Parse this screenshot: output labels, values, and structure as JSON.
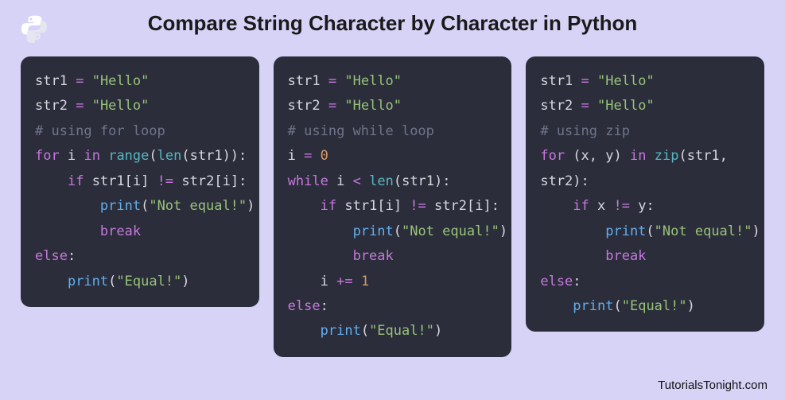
{
  "title": "Compare String Character by Character in Python",
  "attribution": "TutorialsTonight.com",
  "logo_name": "python-logo",
  "panels": [
    {
      "name": "for-loop-panel",
      "comment": "# using for loop",
      "code": [
        [
          [
            "var",
            "str1"
          ],
          [
            "pun",
            " "
          ],
          [
            "op",
            "="
          ],
          [
            "pun",
            " "
          ],
          [
            "str",
            "\"Hello\""
          ]
        ],
        [
          [
            "var",
            "str2"
          ],
          [
            "pun",
            " "
          ],
          [
            "op",
            "="
          ],
          [
            "pun",
            " "
          ],
          [
            "str",
            "\"Hello\""
          ]
        ],
        [
          [
            "com",
            "# using for loop"
          ]
        ],
        [
          [
            "kw",
            "for"
          ],
          [
            "pun",
            " "
          ],
          [
            "var",
            "i"
          ],
          [
            "pun",
            " "
          ],
          [
            "kw",
            "in"
          ],
          [
            "pun",
            " "
          ],
          [
            "bfn",
            "range"
          ],
          [
            "pun",
            "("
          ],
          [
            "bfn",
            "len"
          ],
          [
            "pun",
            "("
          ],
          [
            "var",
            "str1"
          ],
          [
            "pun",
            "))"
          ],
          [
            "pun",
            ":"
          ]
        ],
        [
          [
            "pun",
            "    "
          ],
          [
            "kw",
            "if"
          ],
          [
            "pun",
            " "
          ],
          [
            "var",
            "str1"
          ],
          [
            "pun",
            "["
          ],
          [
            "var",
            "i"
          ],
          [
            "pun",
            "]"
          ],
          [
            "pun",
            " "
          ],
          [
            "op",
            "!="
          ],
          [
            "pun",
            " "
          ],
          [
            "var",
            "str2"
          ],
          [
            "pun",
            "["
          ],
          [
            "var",
            "i"
          ],
          [
            "pun",
            "]"
          ],
          [
            "pun",
            ":"
          ]
        ],
        [
          [
            "pun",
            "        "
          ],
          [
            "fn",
            "print"
          ],
          [
            "pun",
            "("
          ],
          [
            "str",
            "\"Not equal!\""
          ],
          [
            "pun",
            ")"
          ]
        ],
        [
          [
            "pun",
            "        "
          ],
          [
            "kw",
            "break"
          ]
        ],
        [
          [
            "kw",
            "else"
          ],
          [
            "pun",
            ":"
          ]
        ],
        [
          [
            "pun",
            "    "
          ],
          [
            "fn",
            "print"
          ],
          [
            "pun",
            "("
          ],
          [
            "str",
            "\"Equal!\""
          ],
          [
            "pun",
            ")"
          ]
        ]
      ]
    },
    {
      "name": "while-loop-panel",
      "comment": "# using while loop",
      "code": [
        [
          [
            "var",
            "str1"
          ],
          [
            "pun",
            " "
          ],
          [
            "op",
            "="
          ],
          [
            "pun",
            " "
          ],
          [
            "str",
            "\"Hello\""
          ]
        ],
        [
          [
            "var",
            "str2"
          ],
          [
            "pun",
            " "
          ],
          [
            "op",
            "="
          ],
          [
            "pun",
            " "
          ],
          [
            "str",
            "\"Hello\""
          ]
        ],
        [
          [
            "com",
            "# using while loop"
          ]
        ],
        [
          [
            "var",
            "i"
          ],
          [
            "pun",
            " "
          ],
          [
            "op",
            "="
          ],
          [
            "pun",
            " "
          ],
          [
            "num",
            "0"
          ]
        ],
        [
          [
            "kw",
            "while"
          ],
          [
            "pun",
            " "
          ],
          [
            "var",
            "i"
          ],
          [
            "pun",
            " "
          ],
          [
            "op",
            "<"
          ],
          [
            "pun",
            " "
          ],
          [
            "bfn",
            "len"
          ],
          [
            "pun",
            "("
          ],
          [
            "var",
            "str1"
          ],
          [
            "pun",
            "):"
          ]
        ],
        [
          [
            "pun",
            "    "
          ],
          [
            "kw",
            "if"
          ],
          [
            "pun",
            " "
          ],
          [
            "var",
            "str1"
          ],
          [
            "pun",
            "["
          ],
          [
            "var",
            "i"
          ],
          [
            "pun",
            "]"
          ],
          [
            "pun",
            " "
          ],
          [
            "op",
            "!="
          ],
          [
            "pun",
            " "
          ],
          [
            "var",
            "str2"
          ],
          [
            "pun",
            "["
          ],
          [
            "var",
            "i"
          ],
          [
            "pun",
            "]"
          ],
          [
            "pun",
            ":"
          ]
        ],
        [
          [
            "pun",
            "        "
          ],
          [
            "fn",
            "print"
          ],
          [
            "pun",
            "("
          ],
          [
            "str",
            "\"Not equal!\""
          ],
          [
            "pun",
            ")"
          ]
        ],
        [
          [
            "pun",
            "        "
          ],
          [
            "kw",
            "break"
          ]
        ],
        [
          [
            "pun",
            "    "
          ],
          [
            "var",
            "i"
          ],
          [
            "pun",
            " "
          ],
          [
            "op",
            "+="
          ],
          [
            "pun",
            " "
          ],
          [
            "num",
            "1"
          ]
        ],
        [
          [
            "kw",
            "else"
          ],
          [
            "pun",
            ":"
          ]
        ],
        [
          [
            "pun",
            "    "
          ],
          [
            "fn",
            "print"
          ],
          [
            "pun",
            "("
          ],
          [
            "str",
            "\"Equal!\""
          ],
          [
            "pun",
            ")"
          ]
        ]
      ]
    },
    {
      "name": "zip-panel",
      "comment": "# using zip",
      "code": [
        [
          [
            "var",
            "str1"
          ],
          [
            "pun",
            " "
          ],
          [
            "op",
            "="
          ],
          [
            "pun",
            " "
          ],
          [
            "str",
            "\"Hello\""
          ]
        ],
        [
          [
            "var",
            "str2"
          ],
          [
            "pun",
            " "
          ],
          [
            "op",
            "="
          ],
          [
            "pun",
            " "
          ],
          [
            "str",
            "\"Hello\""
          ]
        ],
        [
          [
            "com",
            "# using zip"
          ]
        ],
        [
          [
            "kw",
            "for"
          ],
          [
            "pun",
            " ("
          ],
          [
            "var",
            "x"
          ],
          [
            "pun",
            ", "
          ],
          [
            "var",
            "y"
          ],
          [
            "pun",
            ") "
          ],
          [
            "kw",
            "in"
          ],
          [
            "pun",
            " "
          ],
          [
            "bfn",
            "zip"
          ],
          [
            "pun",
            "("
          ],
          [
            "var",
            "str1"
          ],
          [
            "pun",
            ","
          ]
        ],
        [
          [
            "var",
            "str2"
          ],
          [
            "pun",
            "):"
          ]
        ],
        [
          [
            "pun",
            "    "
          ],
          [
            "kw",
            "if"
          ],
          [
            "pun",
            " "
          ],
          [
            "var",
            "x"
          ],
          [
            "pun",
            " "
          ],
          [
            "op",
            "!="
          ],
          [
            "pun",
            " "
          ],
          [
            "var",
            "y"
          ],
          [
            "pun",
            ":"
          ]
        ],
        [
          [
            "pun",
            "        "
          ],
          [
            "fn",
            "print"
          ],
          [
            "pun",
            "("
          ],
          [
            "str",
            "\"Not equal!\""
          ],
          [
            "pun",
            ")"
          ]
        ],
        [
          [
            "pun",
            "        "
          ],
          [
            "kw",
            "break"
          ]
        ],
        [
          [
            "kw",
            "else"
          ],
          [
            "pun",
            ":"
          ]
        ],
        [
          [
            "pun",
            "    "
          ],
          [
            "fn",
            "print"
          ],
          [
            "pun",
            "("
          ],
          [
            "str",
            "\"Equal!\""
          ],
          [
            "pun",
            ")"
          ]
        ]
      ]
    }
  ]
}
